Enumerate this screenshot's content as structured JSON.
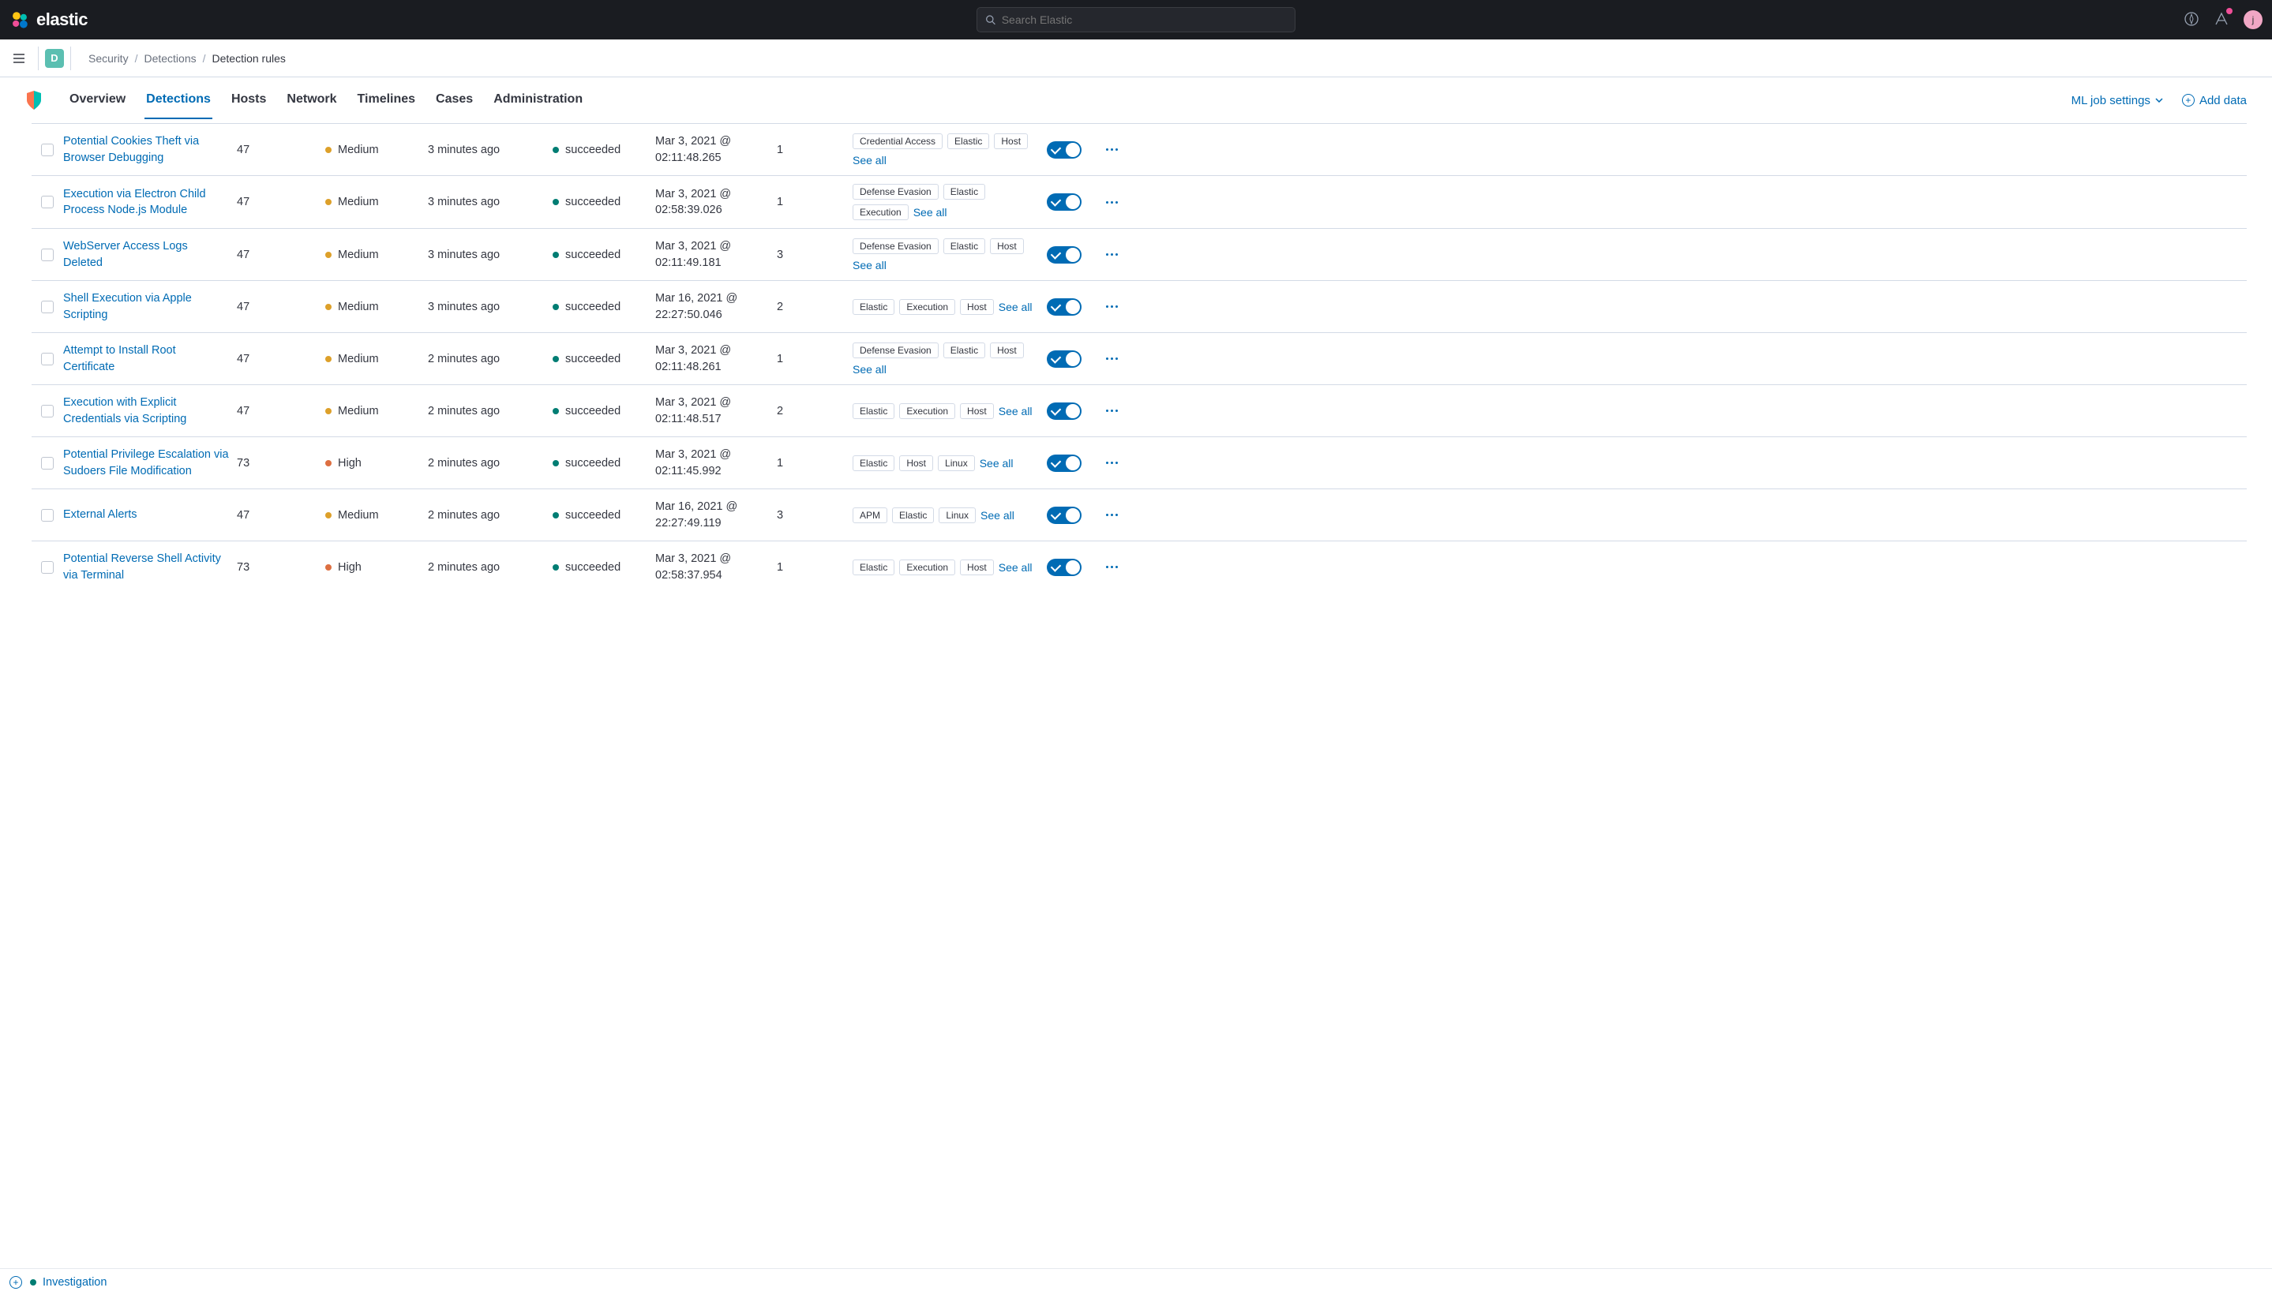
{
  "header": {
    "logo_text": "elastic",
    "search_placeholder": "Search Elastic",
    "avatar_letter": "j"
  },
  "breadcrumb": {
    "space_letter": "D",
    "items": [
      "Security",
      "Detections",
      "Detection rules"
    ]
  },
  "nav": {
    "tabs": [
      "Overview",
      "Detections",
      "Hosts",
      "Network",
      "Timelines",
      "Cases",
      "Administration"
    ],
    "active_index": 1,
    "ml_settings": "ML job settings",
    "add_data": "Add data"
  },
  "table": {
    "see_all_label": "See all",
    "rows": [
      {
        "name": "Potential Cookies Theft via Browser Debugging",
        "risk": "47",
        "severity": "Medium",
        "severity_class": "sev-medium",
        "lastrun": "3 minutes ago",
        "response": "succeeded",
        "updated": "Mar 3, 2021 @ 02:11:48.265",
        "version": "1",
        "tags": [
          "Credential Access",
          "Elastic",
          "Host"
        ]
      },
      {
        "name": "Execution via Electron Child Process Node.js Module",
        "risk": "47",
        "severity": "Medium",
        "severity_class": "sev-medium",
        "lastrun": "3 minutes ago",
        "response": "succeeded",
        "updated": "Mar 3, 2021 @ 02:58:39.026",
        "version": "1",
        "tags": [
          "Defense Evasion",
          "Elastic",
          "Execution"
        ]
      },
      {
        "name": "WebServer Access Logs Deleted",
        "risk": "47",
        "severity": "Medium",
        "severity_class": "sev-medium",
        "lastrun": "3 minutes ago",
        "response": "succeeded",
        "updated": "Mar 3, 2021 @ 02:11:49.181",
        "version": "3",
        "tags": [
          "Defense Evasion",
          "Elastic",
          "Host"
        ]
      },
      {
        "name": "Shell Execution via Apple Scripting",
        "risk": "47",
        "severity": "Medium",
        "severity_class": "sev-medium",
        "lastrun": "3 minutes ago",
        "response": "succeeded",
        "updated": "Mar 16, 2021 @ 22:27:50.046",
        "version": "2",
        "tags": [
          "Elastic",
          "Execution",
          "Host"
        ]
      },
      {
        "name": "Attempt to Install Root Certificate",
        "risk": "47",
        "severity": "Medium",
        "severity_class": "sev-medium",
        "lastrun": "2 minutes ago",
        "response": "succeeded",
        "updated": "Mar 3, 2021 @ 02:11:48.261",
        "version": "1",
        "tags": [
          "Defense Evasion",
          "Elastic",
          "Host"
        ]
      },
      {
        "name": "Execution with Explicit Credentials via Scripting",
        "risk": "47",
        "severity": "Medium",
        "severity_class": "sev-medium",
        "lastrun": "2 minutes ago",
        "response": "succeeded",
        "updated": "Mar 3, 2021 @ 02:11:48.517",
        "version": "2",
        "tags": [
          "Elastic",
          "Execution",
          "Host"
        ]
      },
      {
        "name": "Potential Privilege Escalation via Sudoers File Modification",
        "risk": "73",
        "severity": "High",
        "severity_class": "sev-high",
        "lastrun": "2 minutes ago",
        "response": "succeeded",
        "updated": "Mar 3, 2021 @ 02:11:45.992",
        "version": "1",
        "tags": [
          "Elastic",
          "Host",
          "Linux"
        ]
      },
      {
        "name": "External Alerts",
        "risk": "47",
        "severity": "Medium",
        "severity_class": "sev-medium",
        "lastrun": "2 minutes ago",
        "response": "succeeded",
        "updated": "Mar 16, 2021 @ 22:27:49.119",
        "version": "3",
        "tags": [
          "APM",
          "Elastic",
          "Linux"
        ]
      },
      {
        "name": "Potential Reverse Shell Activity via Terminal",
        "risk": "73",
        "severity": "High",
        "severity_class": "sev-high",
        "lastrun": "2 minutes ago",
        "response": "succeeded",
        "updated": "Mar 3, 2021 @ 02:58:37.954",
        "version": "1",
        "tags": [
          "Elastic",
          "Execution",
          "Host"
        ]
      }
    ]
  },
  "footer": {
    "text": "Investigation"
  }
}
